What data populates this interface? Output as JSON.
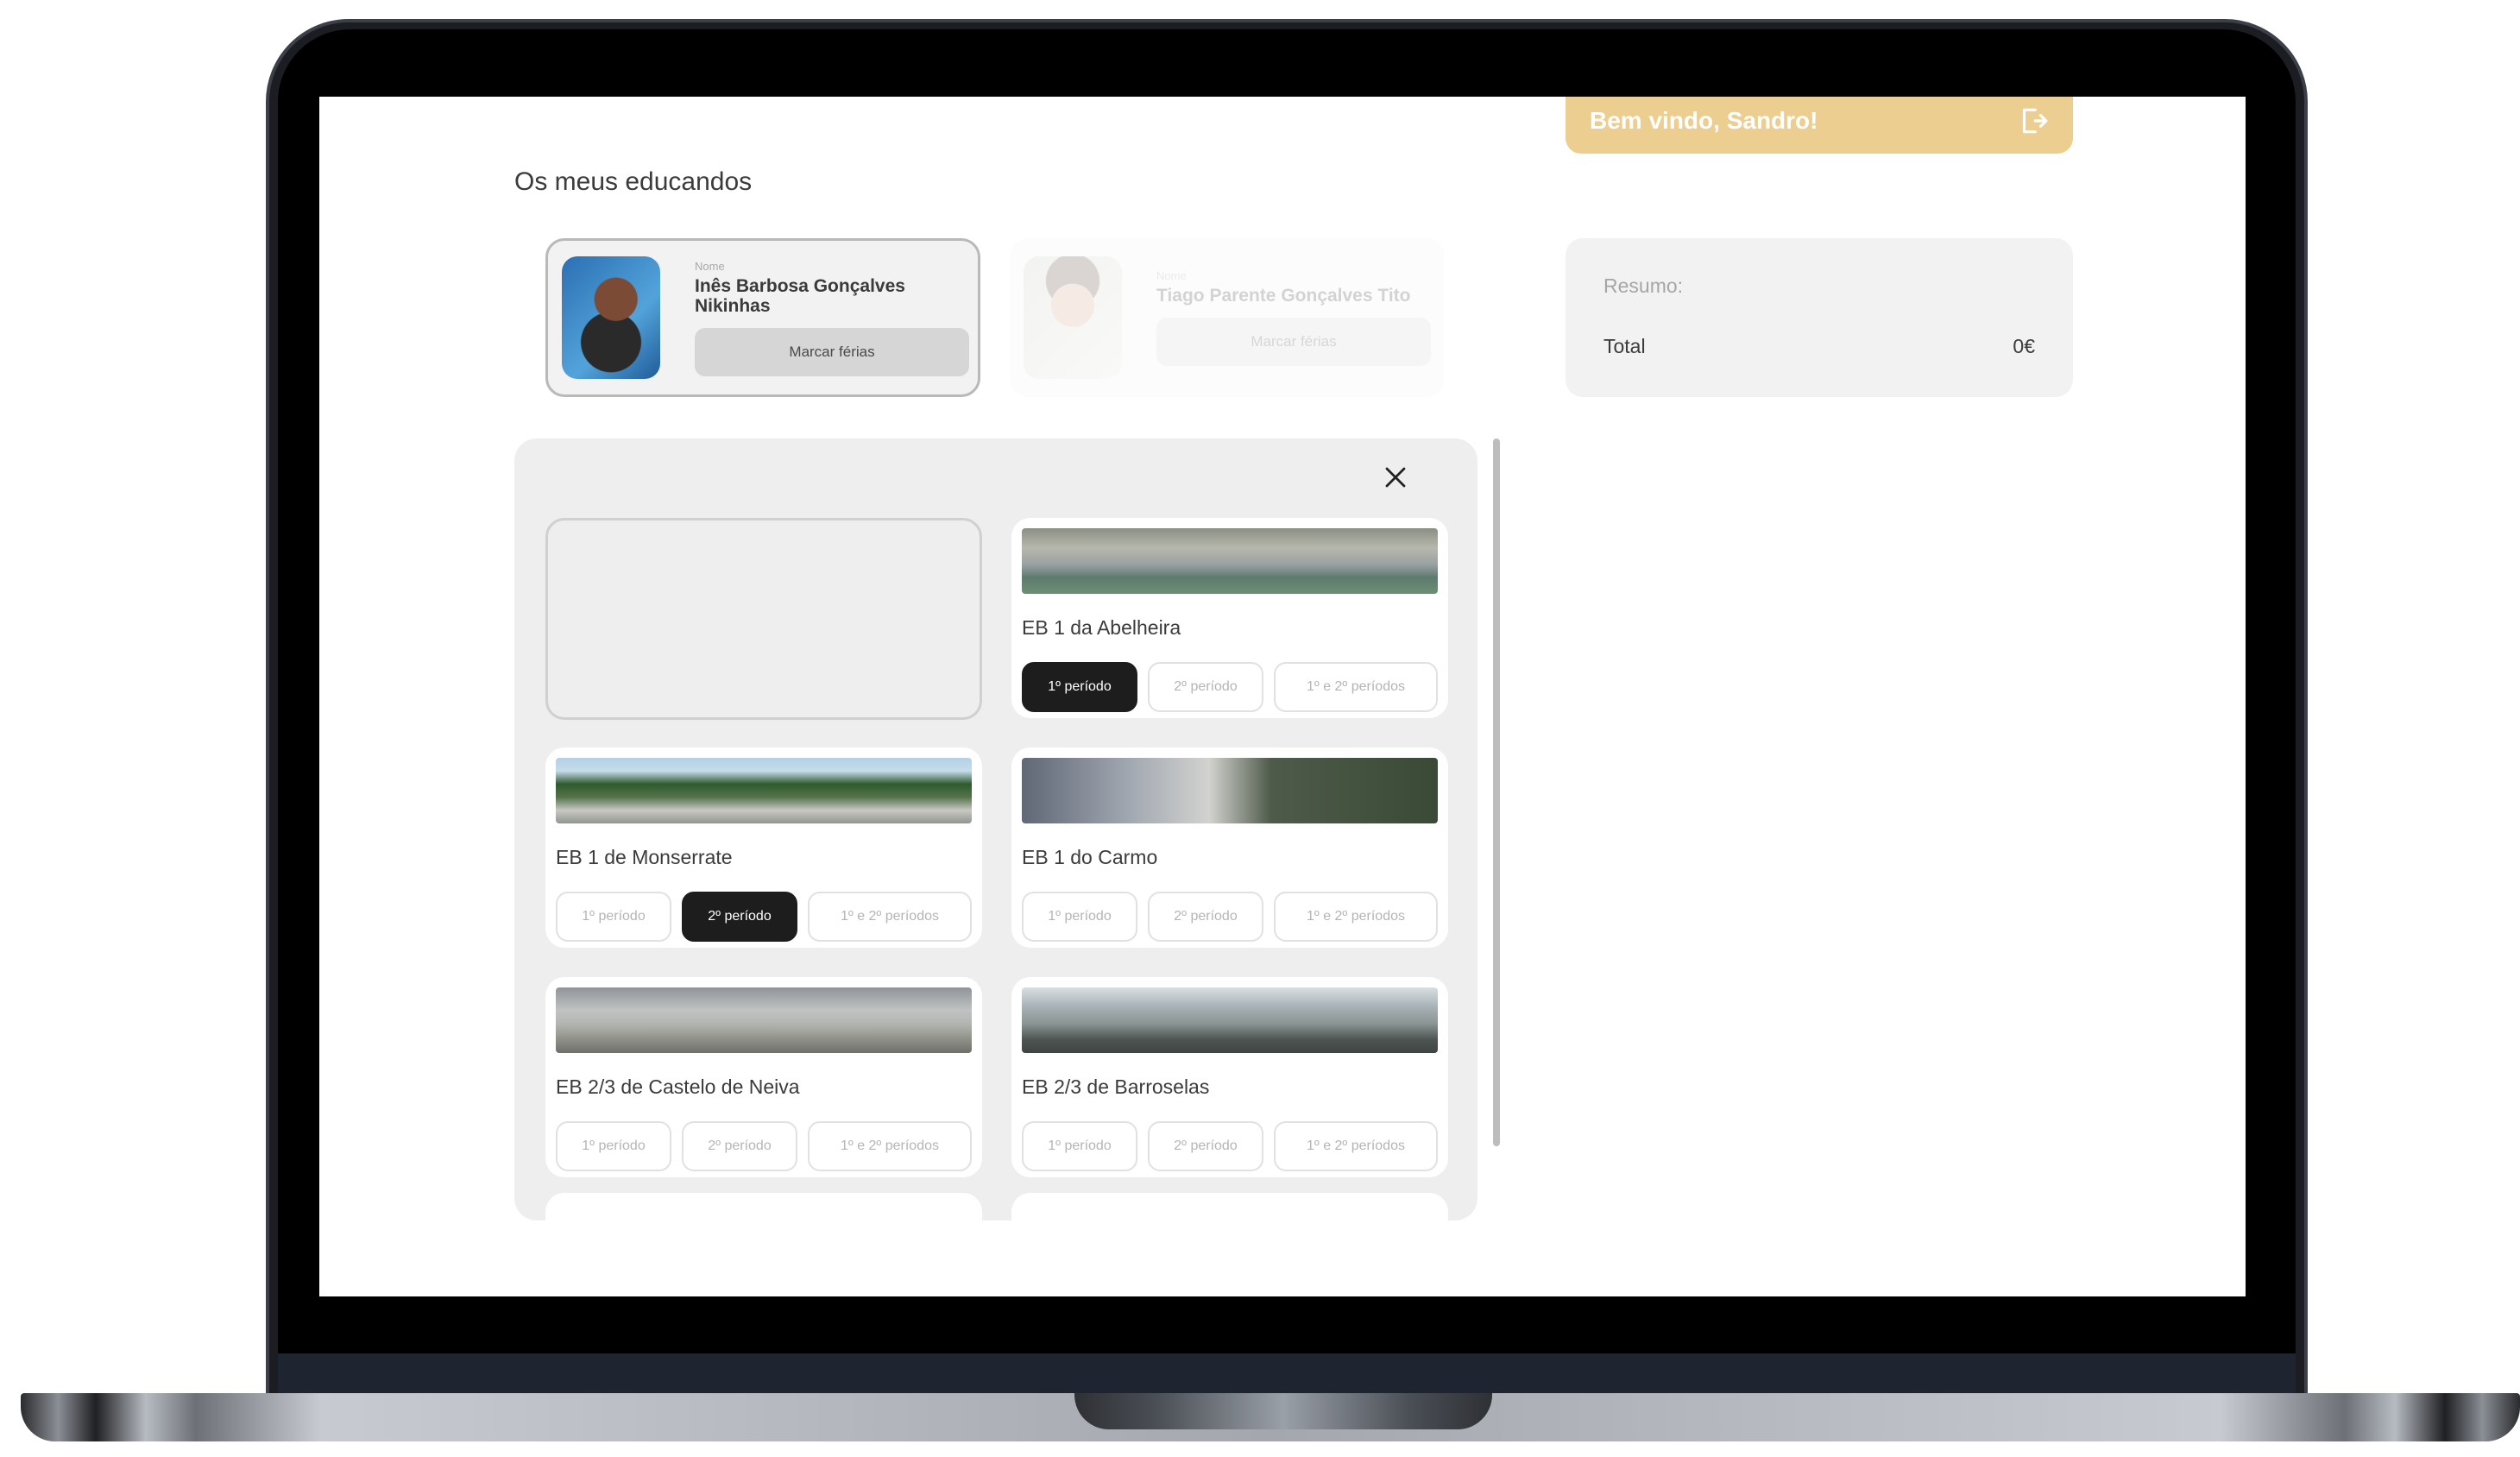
{
  "header": {
    "welcome": "Bem vindo, Sandro!"
  },
  "students_section": {
    "title": "Os meus educandos",
    "field_label": "Nome",
    "students": [
      {
        "name": "Inês Barbosa Gonçalves Nikinhas",
        "button": "Marcar férias"
      },
      {
        "name": "Tiago Parente Gonçalves Tito",
        "button": "Marcar férias"
      }
    ]
  },
  "summary": {
    "title": "Resumo:",
    "total_label": "Total",
    "total_value": "0€"
  },
  "period_labels": [
    "1º período",
    "2º período",
    "1º e 2º períodos"
  ],
  "schools": [
    {
      "name": "EB 1 da Abelheira",
      "selected": "1º período"
    },
    {
      "name": "EB 1 de Monserrate",
      "selected": "2º período"
    },
    {
      "name": "EB 1 do Carmo",
      "selected": ""
    },
    {
      "name": "EB 2/3 de Castelo de Neiva",
      "selected": ""
    },
    {
      "name": "EB 2/3 de Barroselas",
      "selected": ""
    }
  ],
  "colors": {
    "accent": "#ecce91",
    "selected": "#1d1d1d"
  }
}
